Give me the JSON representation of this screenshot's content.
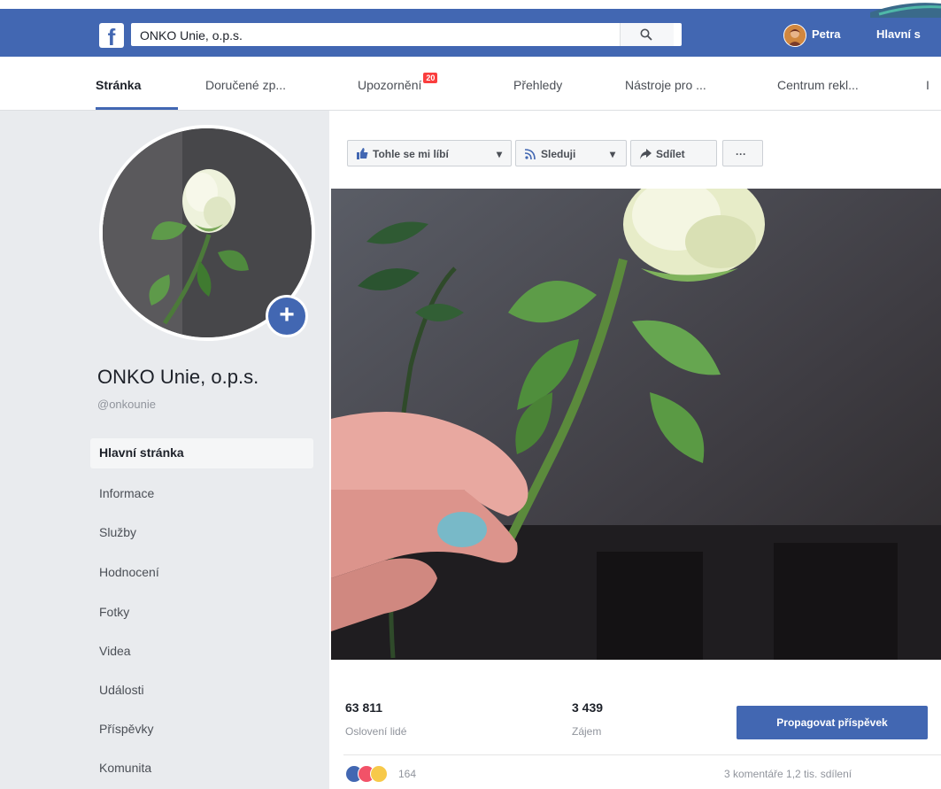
{
  "topbar": {
    "logo": "f",
    "search_value": "ONKO Unie, o.p.s.",
    "user_name": "Petra",
    "home_label": "Hlavní s"
  },
  "tabs": [
    {
      "label": "Stránka",
      "active": true
    },
    {
      "label": "Doručené zp..."
    },
    {
      "label": "Upozornění",
      "badge": "20"
    },
    {
      "label": "Přehledy"
    },
    {
      "label": "Nástroje pro ..."
    },
    {
      "label": "Centrum rekl..."
    },
    {
      "label": "I"
    }
  ],
  "profile": {
    "name": "ONKO Unie, o.p.s.",
    "handle": "@onkounie",
    "add_icon": "plus-icon"
  },
  "nav": [
    {
      "label": "Hlavní stránka",
      "active": true
    },
    {
      "label": "Informace"
    },
    {
      "label": "Služby"
    },
    {
      "label": "Hodnocení"
    },
    {
      "label": "Fotky"
    },
    {
      "label": "Videa"
    },
    {
      "label": "Události"
    },
    {
      "label": "Příspěvky"
    },
    {
      "label": "Komunita"
    }
  ],
  "actions": {
    "like": "Tohle se mi líbí",
    "follow": "Sleduji",
    "share": "Sdílet",
    "more": "···"
  },
  "stats": {
    "reach_value": "63 811",
    "reach_label": "Oslovení lidé",
    "engagement_value": "3 439",
    "engagement_label": "Zájem",
    "promote_label": "Propagovat příspěvek",
    "reactions_count": "164",
    "comments_shares": "3 komentáře  1,2 tis. sdílení"
  },
  "colors": {
    "brand": "#4267b2",
    "badge": "#fa3e3e",
    "background": "#e9ebee"
  }
}
